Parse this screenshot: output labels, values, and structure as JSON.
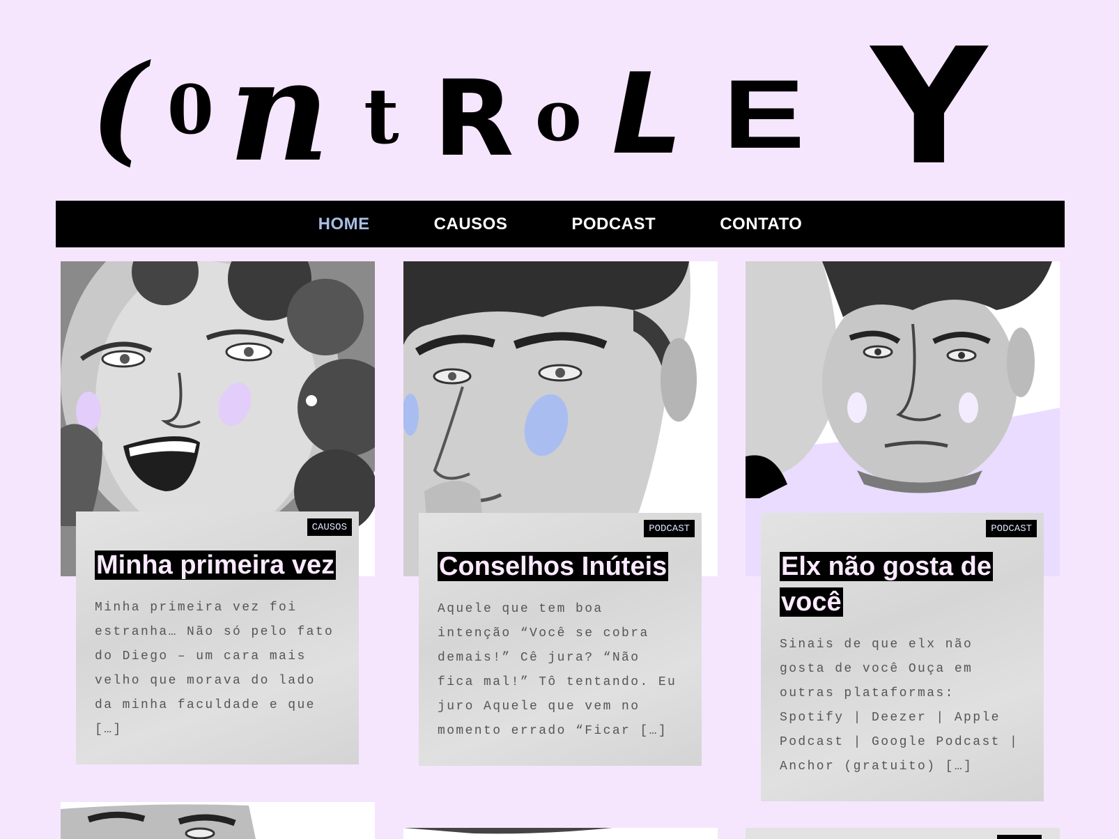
{
  "site": {
    "logo_text": "CoNtRoLE Y"
  },
  "nav": {
    "items": [
      {
        "label": "HOME",
        "active": true
      },
      {
        "label": "CAUSOS",
        "active": false
      },
      {
        "label": "PODCAST",
        "active": false
      },
      {
        "label": "CONTATO",
        "active": false
      }
    ]
  },
  "posts": [
    {
      "category": "CAUSOS",
      "title": "Minha primeira vez",
      "excerpt": "Minha primeira vez foi estranha… Não só pelo fato do Diego – um cara mais velho que morava do lado da minha faculdade e que […]",
      "blush_color": "#e3cdfa"
    },
    {
      "category": "PODCAST",
      "title": "Conselhos Inúteis",
      "excerpt": "Aquele que tem boa intenção “Você se cobra demais!” Cê jura? “Não fica mal!” Tô tentando. Eu juro Aquele que vem no momento errado “Ficar […]",
      "blush_color": "#a9bdf0"
    },
    {
      "category": "PODCAST",
      "title": "Elx não gosta de você",
      "excerpt": "Sinais de que elx não gosta de você Ouça em outras plataformas:   Spotify   |  Deezer   |  Apple Podcast  |   Google Podcast   |  Anchor (gratuito) […]",
      "blush_color": "#f3ecff"
    }
  ],
  "colors": {
    "page_bg": "#f5e6fd",
    "nav_bg": "#000000",
    "nav_active": "#a8bfe6",
    "title_text": "#fbe9ff",
    "badge_text": "#dbe4ff"
  }
}
